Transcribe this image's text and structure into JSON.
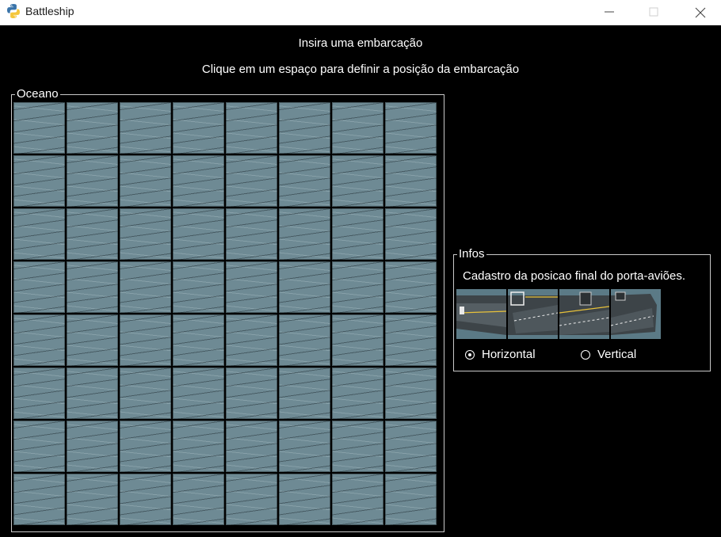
{
  "window": {
    "title": "Battleship",
    "app_icon": "python-icon",
    "controls": [
      "minimize-icon",
      "maximize-icon",
      "close-icon"
    ]
  },
  "header": {
    "line1": "Insira uma embarcação",
    "line2": "Clique em um espaço para definir a posição da embarcação"
  },
  "ocean": {
    "legend": "Oceano",
    "rows": 8,
    "cols": 8,
    "cell_icon": "water-tile-icon",
    "cell_color": "#6e8a94"
  },
  "infos": {
    "legend": "Infos",
    "text": "Cadastro da posicao final do porta-aviões.",
    "ship_icons": [
      "carrier-stern-icon",
      "carrier-deck-icon",
      "carrier-mid-icon",
      "carrier-bow-icon"
    ],
    "orientation": {
      "horizontal": "Horizontal",
      "vertical": "Vertical",
      "selected": "Horizontal"
    }
  }
}
